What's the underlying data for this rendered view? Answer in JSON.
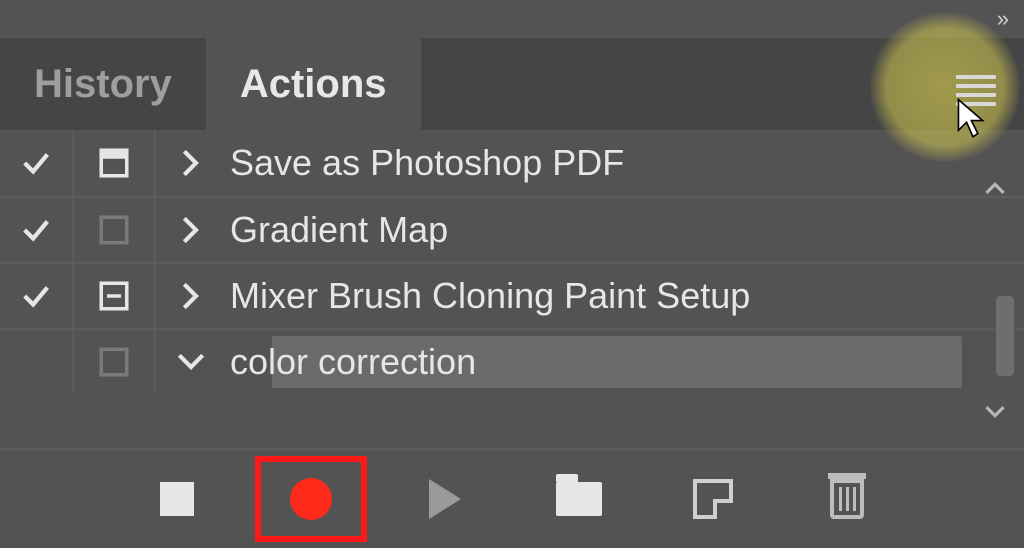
{
  "tabs": {
    "history": "History",
    "actions": "Actions",
    "active": "actions"
  },
  "rows": [
    {
      "checked": true,
      "dialog": "full",
      "expand": "right",
      "label": "Save as Photoshop PDF",
      "selected": false
    },
    {
      "checked": true,
      "dialog": "empty",
      "expand": "right",
      "label": "Gradient Map",
      "selected": false
    },
    {
      "checked": true,
      "dialog": "minus",
      "expand": "right",
      "label": "Mixer Brush Cloning Paint Setup",
      "selected": false
    },
    {
      "checked": false,
      "dialog": "empty",
      "expand": "down",
      "label": "color correction",
      "selected": true
    }
  ],
  "footer": {
    "stop": "stop",
    "record": "record",
    "play": "play",
    "folder": "new-set",
    "newdoc": "new-action",
    "trash": "delete"
  },
  "colors": {
    "panel": "#535353",
    "tabbar": "#454545",
    "highlight": "#ff1a1a"
  }
}
